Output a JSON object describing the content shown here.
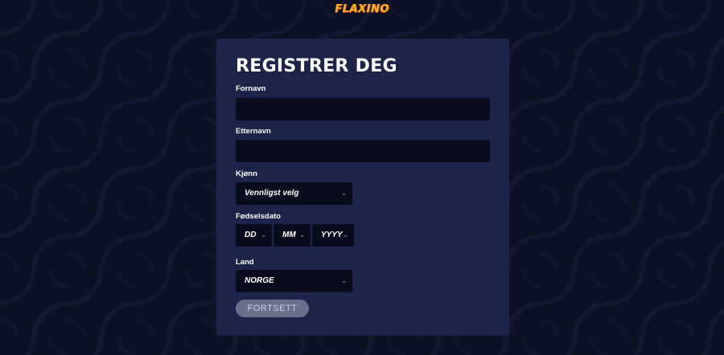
{
  "brand": {
    "logo_text": "FLAXINO"
  },
  "form": {
    "title": "REGISTRER DEG",
    "first_name": {
      "label": "Fornavn",
      "value": ""
    },
    "last_name": {
      "label": "Etternavn",
      "value": ""
    },
    "gender": {
      "label": "Kjønn",
      "selected": "Vennligst velg"
    },
    "birthdate": {
      "label": "Fødselsdato",
      "day": "DD",
      "month": "MM",
      "year": "YYYY"
    },
    "country": {
      "label": "Land",
      "selected": "NORGE"
    },
    "submit_label": "FORTSETT"
  },
  "icons": {
    "dropdown": "chevron-down-icon"
  },
  "colors": {
    "page_background": "#0d1124",
    "card_background": "#1c2549",
    "input_background": "#090c1c",
    "logo": "#ffb21c",
    "button_disabled": "#6a7089"
  }
}
